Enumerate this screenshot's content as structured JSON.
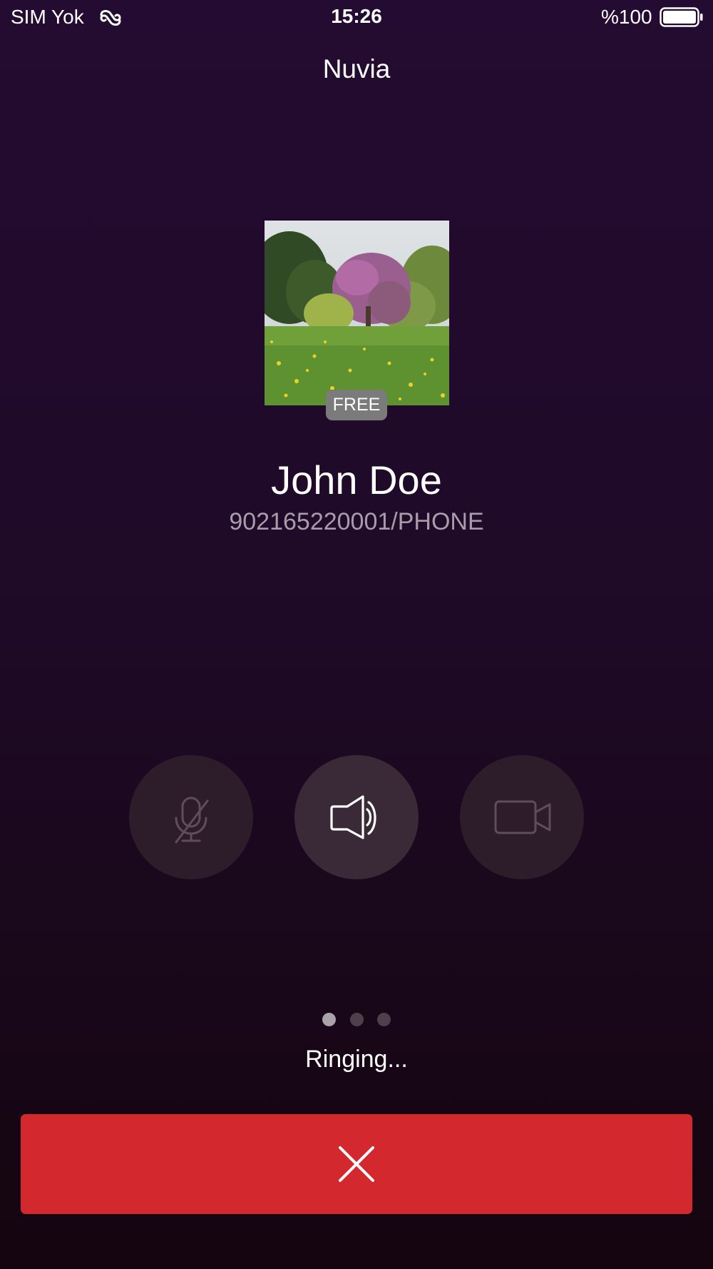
{
  "status_bar": {
    "carrier": "SIM Yok",
    "time": "15:26",
    "battery": "%100"
  },
  "app_title": "Nuvia",
  "caller": {
    "badge": "FREE",
    "name": "John Doe",
    "number": "902165220001/PHONE"
  },
  "controls": {
    "mute": {
      "icon": "microphone-muted-icon",
      "enabled": false
    },
    "speaker": {
      "icon": "speaker-icon",
      "enabled": true
    },
    "video": {
      "icon": "video-camera-icon",
      "enabled": false
    }
  },
  "pager": {
    "count": 3,
    "active": 1
  },
  "call_status": "Ringing...",
  "end_call": {
    "icon": "close-icon"
  },
  "colors": {
    "end_call": "#d4282f",
    "badge": "#7b7b7b",
    "background_top": "#240b31",
    "background_bottom": "#14050f"
  }
}
